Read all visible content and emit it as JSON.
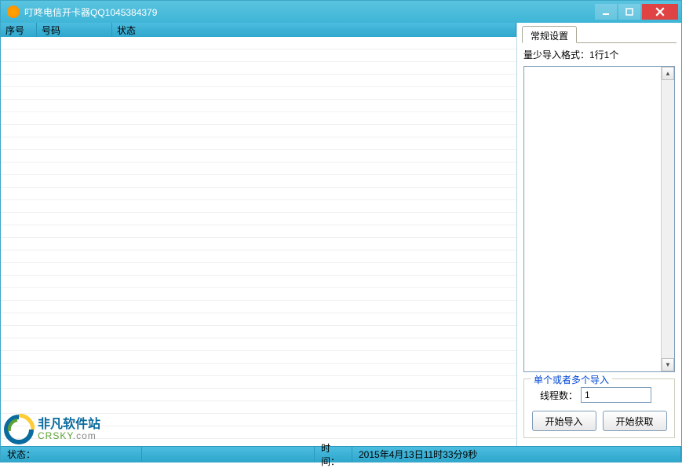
{
  "window": {
    "title": "叮咚电信开卡器QQ1045384379"
  },
  "table": {
    "headers": {
      "seq": "序号",
      "number": "号码",
      "status": "状态"
    }
  },
  "settings": {
    "tabLabel": "常规设置",
    "formatHint": "量少导入格式：1行1个"
  },
  "importGroup": {
    "legend": "单个或者多个导入",
    "threadLabel": "线程数：",
    "threadValue": "1",
    "startImport": "开始导入",
    "startFetch": "开始获取"
  },
  "statusbar": {
    "statusLabel": "状态：",
    "statusValue": "",
    "timeLabel": "时间：",
    "timeValue": "2015年4月13日11时33分9秒"
  },
  "watermark": {
    "cn": "非凡软件站",
    "en": "CRSKY",
    "dot": ".com"
  }
}
